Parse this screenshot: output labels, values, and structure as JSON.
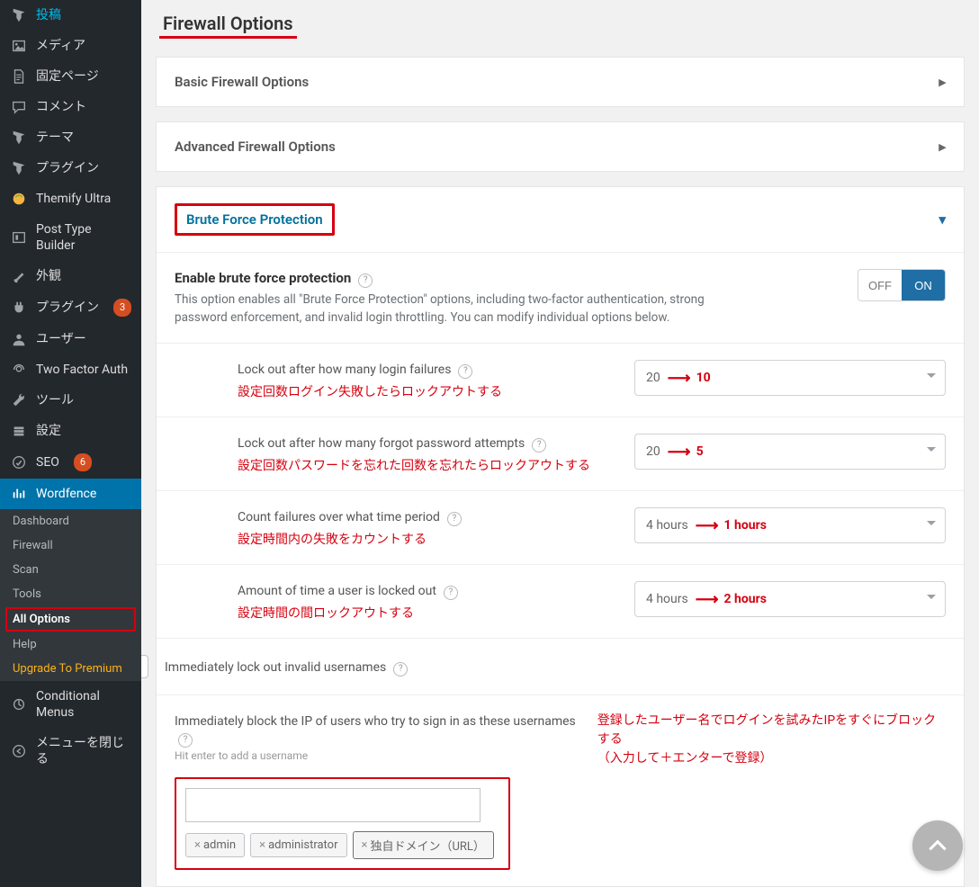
{
  "page_title": "Firewall Options",
  "sidebar": {
    "items": [
      {
        "icon": "pin",
        "label": "投稿"
      },
      {
        "icon": "media",
        "label": "メディア"
      },
      {
        "icon": "page",
        "label": "固定ページ"
      },
      {
        "icon": "comment",
        "label": "コメント"
      },
      {
        "icon": "pin",
        "label": "テーマ"
      },
      {
        "icon": "pin",
        "label": "プラグイン"
      },
      {
        "icon": "themify",
        "label": "Themify Ultra"
      },
      {
        "icon": "ptb",
        "label": "Post Type Builder"
      },
      {
        "icon": "brush",
        "label": "外観"
      },
      {
        "icon": "plugin",
        "label": "プラグイン",
        "badge": "3"
      },
      {
        "icon": "user",
        "label": "ユーザー"
      },
      {
        "icon": "2fa",
        "label": "Two Factor Auth"
      },
      {
        "icon": "tools",
        "label": "ツール"
      },
      {
        "icon": "settings",
        "label": "設定"
      },
      {
        "icon": "seo",
        "label": "SEO",
        "badge": "6"
      },
      {
        "icon": "wf",
        "label": "Wordfence",
        "active": true
      }
    ],
    "sub": [
      {
        "label": "Dashboard"
      },
      {
        "label": "Firewall"
      },
      {
        "label": "Scan"
      },
      {
        "label": "Tools"
      },
      {
        "label": "All Options",
        "sel": true
      },
      {
        "label": "Help"
      },
      {
        "label": "Upgrade To Premium",
        "premium": true
      }
    ],
    "post_items": [
      {
        "icon": "cond",
        "label": "Conditional Menus"
      },
      {
        "icon": "collapse",
        "label": "メニューを閉じる"
      }
    ]
  },
  "panels": {
    "basic": "Basic Firewall Options",
    "advanced": "Advanced Firewall Options",
    "brute": "Brute Force Protection"
  },
  "enable": {
    "label": "Enable brute force protection",
    "desc": "This option enables all \"Brute Force Protection\" options, including two-factor authentication, strong password enforcement, and invalid login throttling. You can modify individual options below.",
    "off": "OFF",
    "on": "ON"
  },
  "rows": [
    {
      "label": "Lock out after how many login failures",
      "value": "20",
      "rec": "10",
      "note": "設定回数ログイン失敗したらロックアウトする"
    },
    {
      "label": "Lock out after how many forgot password attempts",
      "value": "20",
      "rec": "5",
      "note": "設定回数パスワードを忘れた回数を忘れたらロックアウトする"
    },
    {
      "label": "Count failures over what time period",
      "value": "4 hours",
      "rec": "1 hours",
      "note": "設定時間内の失敗をカウントする"
    },
    {
      "label": "Amount of time a user is locked out",
      "value": "4 hours",
      "rec": "2 hours",
      "note": "設定時間の間ロックアウトする"
    }
  ],
  "immediate_invalid": "Immediately lock out invalid usernames",
  "block_ip": {
    "label": "Immediately block the IP of users who try to sign in as these usernames",
    "hint": "Hit enter to add a username",
    "right1": "登録したユーザー名でログインを試みたIPをすぐにブロックする",
    "right2": "（入力して＋エンターで登録）",
    "tags": [
      "admin",
      "administrator",
      "独自ドメイン（URL）"
    ]
  }
}
